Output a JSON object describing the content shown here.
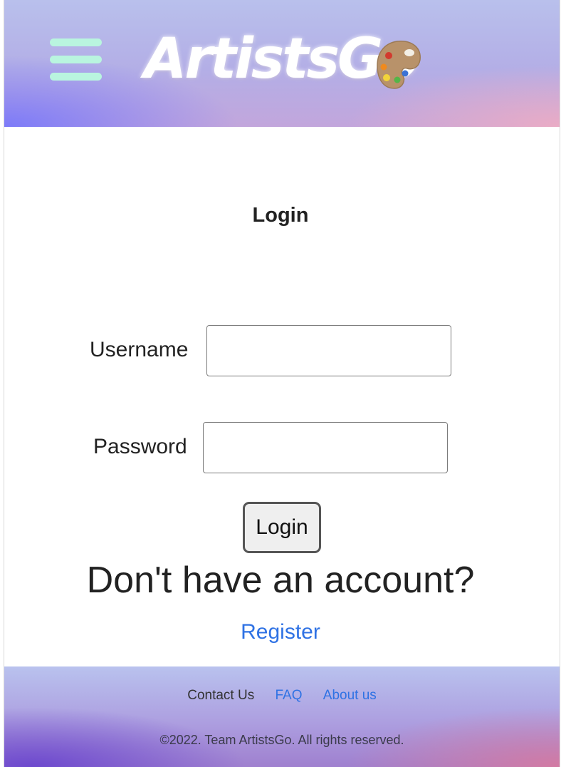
{
  "header": {
    "logo_text": "ArtistsGo",
    "menu_icon": "hamburger-menu-icon",
    "logo_icon": "palette-icon",
    "menu_color": "#b9f5df"
  },
  "main": {
    "title": "Login",
    "username_label": "Username",
    "username_value": "",
    "password_label": "Password",
    "password_value": "",
    "login_button_label": "Login",
    "no_account_text": "Don't have an account?",
    "register_link": "Register"
  },
  "footer": {
    "links": [
      "Contact Us",
      "FAQ",
      "About us"
    ],
    "copyright": "©2022. Team ArtistsGo. All rights reserved."
  },
  "colors": {
    "link": "#2f72e4",
    "text": "#222222"
  }
}
